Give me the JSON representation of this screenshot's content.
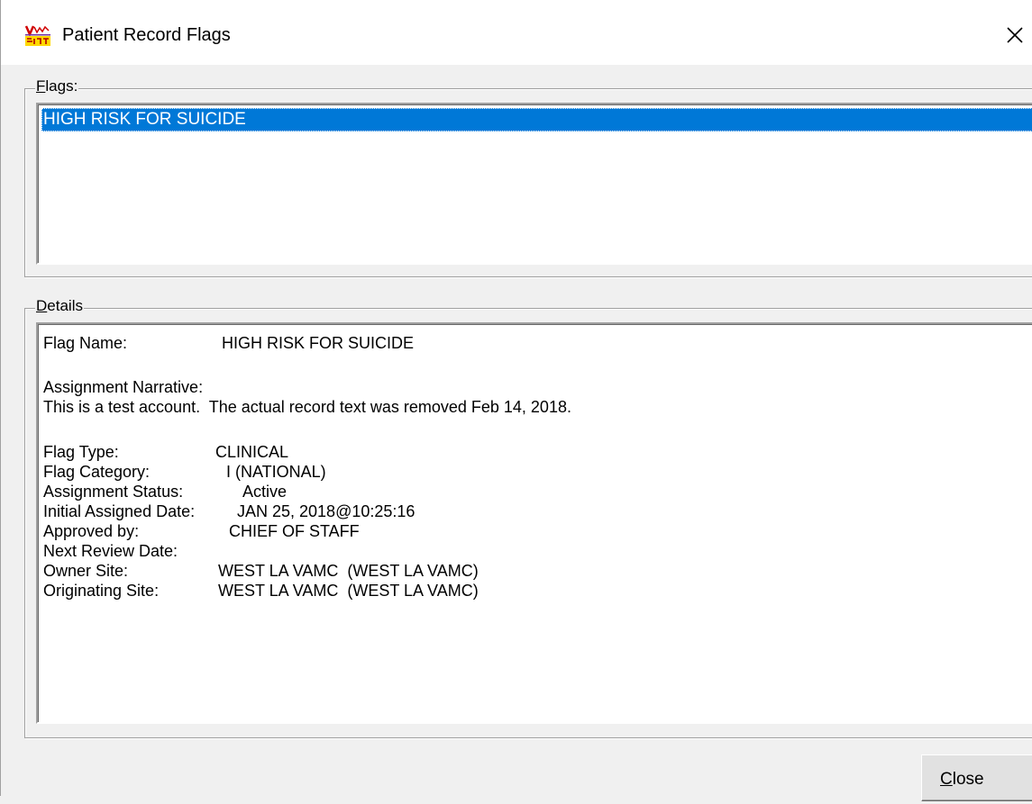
{
  "window": {
    "title": "Patient Record Flags",
    "icon": "cprs-app-icon",
    "close_icon": "close-icon"
  },
  "flags_group": {
    "label_accel": "F",
    "label_rest": "lags:",
    "items": [
      "HIGH RISK FOR SUICIDE"
    ],
    "selected_index": 0
  },
  "details_group": {
    "label_accel": "D",
    "label_rest": "etails",
    "lines": {
      "flag_name_label": "Flag Name:",
      "flag_name_value": "HIGH RISK FOR SUICIDE",
      "narrative_label": "Assignment Narrative:",
      "narrative_text": "This is a test account.  The actual record text was removed Feb 14, 2018.",
      "flag_type_label": "Flag Type:",
      "flag_type_value": "CLINICAL",
      "flag_category_label": "Flag Category:",
      "flag_category_value": "I (NATIONAL)",
      "assignment_status_label": "Assignment Status:",
      "assignment_status_value": "Active",
      "initial_assigned_label": "Initial Assigned Date:",
      "initial_assigned_value": "JAN 25, 2018@10:25:16",
      "approved_by_label": "Approved by:",
      "approved_by_value": "CHIEF OF STAFF",
      "next_review_label": "Next Review Date:",
      "owner_site_label": "Owner Site:",
      "owner_site_value": "WEST LA VAMC  (WEST LA VAMC)",
      "originating_site_label": "Originating Site:",
      "originating_site_value": "WEST LA VAMC  (WEST LA VAMC)"
    }
  },
  "buttons": {
    "close_accel": "C",
    "close_rest": "lose"
  },
  "colors": {
    "selection": "#0078d7",
    "window_bg": "#f0f0f0",
    "title_bg": "#ffffff"
  }
}
